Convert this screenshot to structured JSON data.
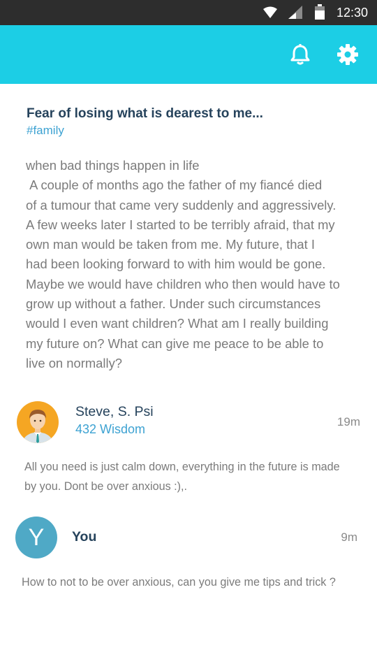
{
  "status_bar": {
    "time": "12:30",
    "icons": [
      "wifi-icon",
      "cellular-signal-icon",
      "battery-icon"
    ]
  },
  "app_bar": {
    "color": "#1ccee5",
    "actions": [
      "bell-icon",
      "gear-icon"
    ]
  },
  "post": {
    "title": "Fear of losing what is dearest to me...",
    "tag": "#family",
    "body": "when bad things happen in life\n A couple of months ago the father of my fiancé died\nof a tumour that came very suddenly and aggressively.\nA few weeks later I started to be terribly afraid, that my\nown man would be taken from me. My future, that I\nhad been looking forward to with him would be gone.\nMaybe we would have children who then would have to\ngrow up without a father. Under such circumstances\nwould I even want children? What am I really building\nmy future on? What can give me peace to be able to\nlive on normally?"
  },
  "comments": [
    {
      "author": "Steve, S. Psi",
      "wisdom": "432 Wisdom",
      "time": "19m",
      "avatar": "male-avatar-icon",
      "text": "All you need is just calm down, everything in the future is made\nby you. Dont be over anxious :),."
    },
    {
      "author": "You",
      "avatar_letter": "Y",
      "time": "9m",
      "text": "How to not to be over anxious, can you give me tips and trick ?"
    }
  ],
  "colors": {
    "accent": "#1ccee5",
    "title": "#26435c",
    "link": "#3da2d2",
    "body_text": "#7b7b7b",
    "you_avatar": "#4fa9c6"
  }
}
